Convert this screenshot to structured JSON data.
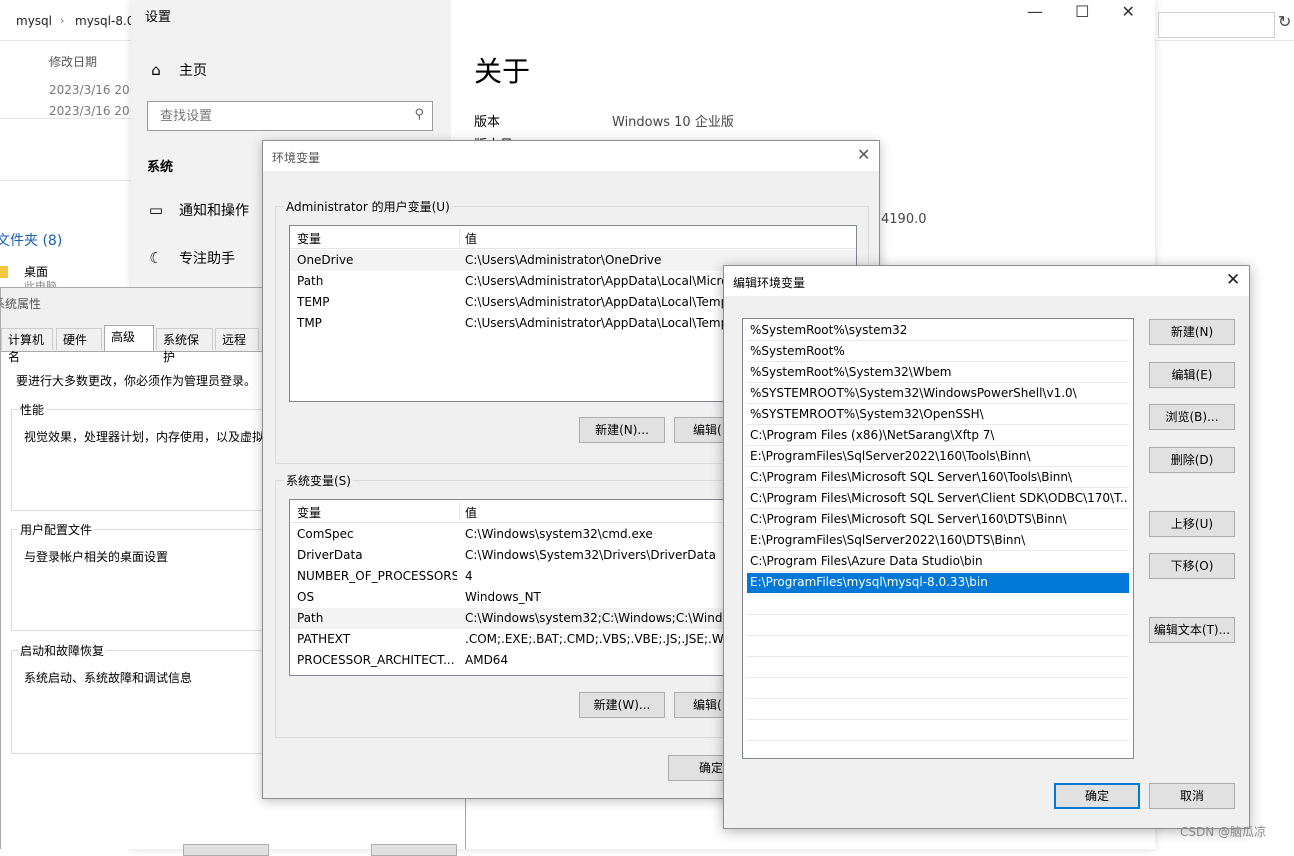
{
  "explorer": {
    "breadcrumb": [
      "mysql",
      "mysql-8.0"
    ],
    "column_header": "修改日期",
    "dates": [
      "2023/3/16 20:",
      "2023/3/16 20:"
    ],
    "folder_group": "文件夹 (8)",
    "folder_item": "桌面",
    "folder_item_sub": "此电脑"
  },
  "settings": {
    "title": "设置",
    "nav_home": "主页",
    "search_placeholder": "查找设置",
    "section": "系统",
    "nav_items": [
      "通知和操作",
      "专注助手"
    ],
    "about_title": "关于",
    "edition_label": "版本",
    "edition_value": "Windows 10 企业版",
    "version_label_fragment": "版本号",
    "build_fragment": "4190.0"
  },
  "system_properties": {
    "title": "系统属性",
    "tabs": [
      "计算机名",
      "硬件",
      "高级",
      "系统保护",
      "远程"
    ],
    "selected_tab": "高级",
    "admin_note": "要进行大多数更改，你必须作为管理员登录。",
    "groups": [
      {
        "label": "性能",
        "text": "视觉效果，处理器计划，内存使用，以及虚拟"
      },
      {
        "label": "用户配置文件",
        "text": "与登录帐户相关的桌面设置"
      },
      {
        "label": "启动和故障恢复",
        "text": "系统启动、系统故障和调试信息"
      }
    ]
  },
  "env_vars": {
    "title": "环境变量",
    "user_group_label": "Administrator 的用户变量(U)",
    "col_var": "变量",
    "col_val": "值",
    "user_vars": [
      {
        "name": "OneDrive",
        "value": "C:\\Users\\Administrator\\OneDrive"
      },
      {
        "name": "Path",
        "value": "C:\\Users\\Administrator\\AppData\\Local\\Micro"
      },
      {
        "name": "TEMP",
        "value": "C:\\Users\\Administrator\\AppData\\Local\\Temp"
      },
      {
        "name": "TMP",
        "value": "C:\\Users\\Administrator\\AppData\\Local\\Temp"
      }
    ],
    "user_new_btn": "新建(N)...",
    "user_edit_btn": "编辑(",
    "sys_group_label": "系统变量(S)",
    "sys_vars": [
      {
        "name": "ComSpec",
        "value": "C:\\Windows\\system32\\cmd.exe"
      },
      {
        "name": "DriverData",
        "value": "C:\\Windows\\System32\\Drivers\\DriverData"
      },
      {
        "name": "NUMBER_OF_PROCESSORS",
        "value": "4"
      },
      {
        "name": "OS",
        "value": "Windows_NT"
      },
      {
        "name": "Path",
        "value": "C:\\Windows\\system32;C:\\Windows;C:\\Windo"
      },
      {
        "name": "PATHEXT",
        "value": ".COM;.EXE;.BAT;.CMD;.VBS;.VBE;.JS;.JSE;.WSF;"
      },
      {
        "name": "PROCESSOR_ARCHITECT...",
        "value": "AMD64"
      }
    ],
    "sys_new_btn": "新建(W)...",
    "sys_edit_btn": "编辑(",
    "ok_btn": "确定"
  },
  "edit_env": {
    "title": "编辑环境变量",
    "entries": [
      "%SystemRoot%\\system32",
      "%SystemRoot%",
      "%SystemRoot%\\System32\\Wbem",
      "%SYSTEMROOT%\\System32\\WindowsPowerShell\\v1.0\\",
      "%SYSTEMROOT%\\System32\\OpenSSH\\",
      "C:\\Program Files (x86)\\NetSarang\\Xftp 7\\",
      "E:\\ProgramFiles\\SqlServer2022\\160\\Tools\\Binn\\",
      "C:\\Program Files\\Microsoft SQL Server\\160\\Tools\\Binn\\",
      "C:\\Program Files\\Microsoft SQL Server\\Client SDK\\ODBC\\170\\T...",
      "C:\\Program Files\\Microsoft SQL Server\\160\\DTS\\Binn\\",
      "E:\\ProgramFiles\\SqlServer2022\\160\\DTS\\Binn\\",
      "C:\\Program Files\\Azure Data Studio\\bin",
      "E:\\ProgramFiles\\mysql\\mysql-8.0.33\\bin"
    ],
    "selected_index": 12,
    "btn_new": "新建(N)",
    "btn_edit": "编辑(E)",
    "btn_browse": "浏览(B)...",
    "btn_delete": "删除(D)",
    "btn_up": "上移(U)",
    "btn_down": "下移(O)",
    "btn_edit_text": "编辑文本(T)...",
    "btn_ok": "确定",
    "btn_cancel": "取消"
  },
  "watermark": "CSDN @脑瓜凉"
}
